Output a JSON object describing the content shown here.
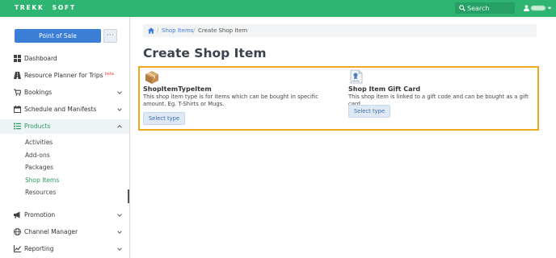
{
  "topbar": {
    "logo_left": "TREKK",
    "logo_right": "SOFT",
    "search_placeholder": "Search"
  },
  "sidebar": {
    "pos_button": "Point of Sale",
    "more_button": "···",
    "items": [
      {
        "label": "Dashboard",
        "icon": "dashboard-icon"
      },
      {
        "label": "Resource Planner for Trips",
        "badge": "beta",
        "icon": "road-icon"
      },
      {
        "label": "Bookings",
        "icon": "cart-icon"
      },
      {
        "label": "Schedule and Manifests",
        "icon": "calendar-icon"
      },
      {
        "label": "Products",
        "icon": "list-icon"
      },
      {
        "label": "Promotion",
        "icon": "megaphone-icon"
      },
      {
        "label": "Channel Manager",
        "icon": "globe-icon"
      },
      {
        "label": "Reporting",
        "icon": "chart-icon"
      }
    ],
    "product_subitems": [
      "Activities",
      "Add-ons",
      "Packages",
      "Shop Items",
      "Resources"
    ]
  },
  "breadcrumb": {
    "items": [
      "Shop Items",
      "Create Shop Item"
    ],
    "separator": "/"
  },
  "page": {
    "title": "Create Shop Item"
  },
  "cards": [
    {
      "title": "ShopItemTypeItem",
      "description": "This shop item type is for items which can be bought in specific amount. Eg. T-Shirts or Mugs.",
      "button": "Select type",
      "icon": "package-box-icon"
    },
    {
      "title": "Shop Item Gift Card",
      "description": "This shop item is linked to a gift code and can be bought as a gift card.",
      "button": "Select type",
      "icon": "gift-certificate-icon"
    }
  ],
  "colors": {
    "brand_green": "#2db571",
    "primary_blue": "#3a7fd5",
    "highlight_orange": "#f0a91e",
    "active_link": "#2a9a5e"
  }
}
